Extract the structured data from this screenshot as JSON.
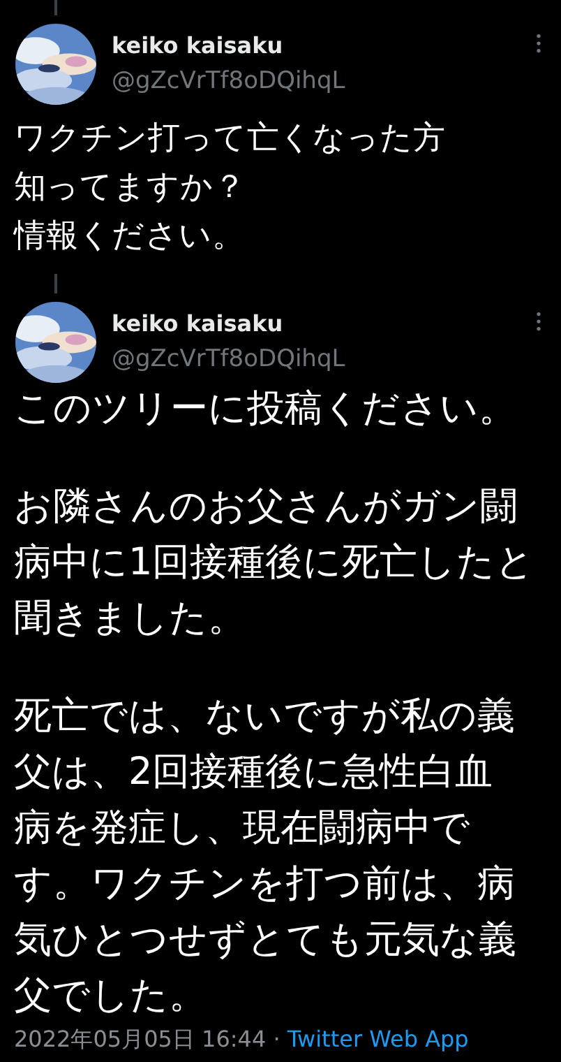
{
  "tweets": [
    {
      "name": "keiko kaisaku",
      "handle": "@gZcVrTf8oDQihqL",
      "paragraphs": [
        [
          "ワクチン打って亡くなった方",
          "知ってますか？",
          "情報ください。"
        ]
      ]
    },
    {
      "name": "keiko kaisaku",
      "handle": "@gZcVrTf8oDQihqL",
      "paragraphs": [
        [
          "このツリーに投稿ください。"
        ],
        [
          "お隣さんのお父さんがガン闘",
          "病中に1回接種後に死亡したと",
          "聞きました。"
        ],
        [
          "死亡では、ないですが私の義",
          "父は、2回接種後に急性白血",
          "病を発症し、現在闘病中で",
          "す。ワクチンを打つ前は、病",
          "気ひとつせずとても元気な義",
          "父でした。"
        ]
      ]
    }
  ],
  "footer": {
    "timestamp": "2022年05月05日 16:44 · ",
    "source": "Twitter Web App"
  }
}
